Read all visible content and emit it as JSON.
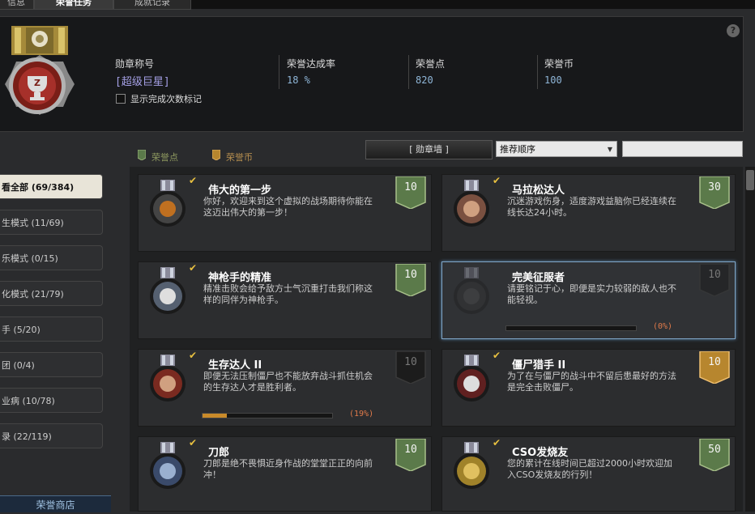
{
  "tabs": [
    {
      "label": "信息"
    },
    {
      "label": "荣誉任务"
    },
    {
      "label": "成就记录"
    }
  ],
  "header": {
    "stats": [
      {
        "label": "勋章称号",
        "value": "[超级巨星]"
      },
      {
        "label": "荣誉达成率",
        "value": "18 %"
      },
      {
        "label": "荣誉点",
        "value": "820"
      },
      {
        "label": "荣誉币",
        "value": "100"
      }
    ],
    "show_count_label": "显示完成次数标记",
    "help_label": "?"
  },
  "filters": {
    "legend_points": "荣誉点",
    "legend_coins": "荣誉币",
    "medal_wall_label": "[ 勋章墙 ]",
    "sort_value": "推荐顺序",
    "search_value": ""
  },
  "sidebar": {
    "items": [
      {
        "label": "看全部 (69/384)"
      },
      {
        "label": "生模式 (11/69)"
      },
      {
        "label": "乐模式 (0/15)"
      },
      {
        "label": "化模式 (21/79)"
      },
      {
        "label": "手 (5/20)"
      },
      {
        "label": "团 (0/4)"
      },
      {
        "label": "业病 (10/78)"
      },
      {
        "label": "录 (22/119)"
      }
    ],
    "shop_label": "荣誉商店"
  },
  "cards": [
    {
      "title": "伟大的第一步",
      "desc": "你好，欢迎来到这个虚拟的战场期待你能在这迈出伟大的第一步！",
      "reward": "10",
      "banner": "green",
      "checked": true,
      "icon": "welcome-cso-medal-icon"
    },
    {
      "title": "马拉松达人",
      "desc": "沉迷游戏伤身，适度游戏益脑你已经连续在线长达24小时。",
      "reward": "30",
      "banner": "green",
      "checked": true,
      "icon": "marathon-medal-icon"
    },
    {
      "title": "神枪手的精准",
      "desc": "精准击败会给予敌方士气沉重打击我们称这样的同伴为神枪手。",
      "reward": "10",
      "banner": "green",
      "checked": true,
      "icon": "skull-medal-icon"
    },
    {
      "title": "完美征服者",
      "desc": "请要铭记于心，即便是实力较弱的敌人也不能轻视。",
      "reward": "10",
      "banner": "dark",
      "checked": false,
      "icon": "conqueror-medal-icon",
      "progress": 0,
      "progress_label": "(0%)"
    },
    {
      "title": "生存达人 II",
      "desc": "即便无法压制僵尸也不能放弃战斗抓住机会的生存达人才是胜利者。",
      "reward": "10",
      "banner": "dark",
      "checked": true,
      "icon": "survivor-medal-icon",
      "progress": 0.19,
      "progress_label": "(19%)"
    },
    {
      "title": "僵尸猎手 II",
      "desc": "为了在与僵尸的战斗中不留后患最好的方法是完全击败僵尸。",
      "reward": "10",
      "banner": "gold",
      "checked": true,
      "icon": "zombie-hunter-medal-icon"
    },
    {
      "title": "刀郎",
      "desc": "刀郎是绝不畏惧近身作战的堂堂正正的向前冲！",
      "reward": "10",
      "banner": "green",
      "checked": true,
      "icon": "knife-medal-icon"
    },
    {
      "title": "CSO发烧友",
      "desc": "您的累计在线时间已超过2000小时欢迎加入CSO发烧友的行列！",
      "reward": "50",
      "banner": "green",
      "checked": true,
      "icon": "cso-fan-medal-icon"
    }
  ],
  "colors": {
    "banner_green": "#5b7a4a",
    "banner_gold": "#b7862e",
    "banner_dark": "#1c1c1c",
    "accent": "#8fb6d8"
  }
}
